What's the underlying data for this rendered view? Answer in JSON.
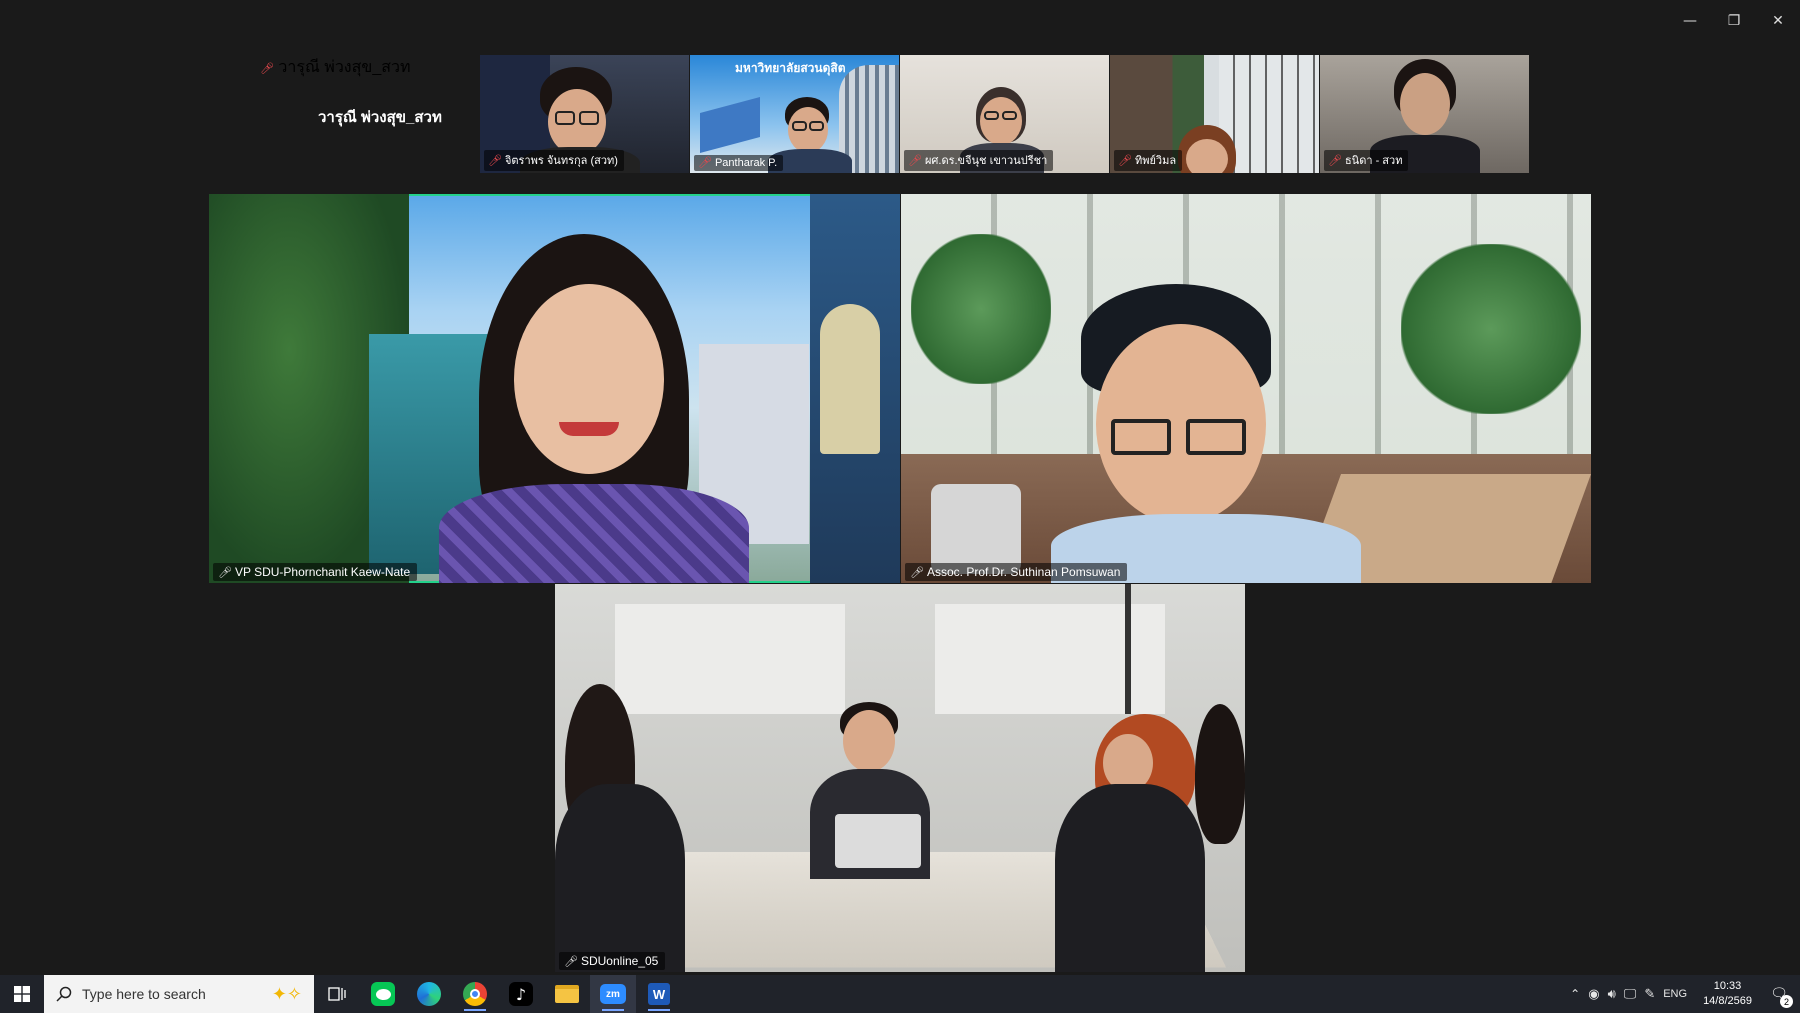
{
  "window": {
    "minimize_icon": "—",
    "restore_icon": "❐",
    "close_icon": "✕"
  },
  "self_view": {
    "title": "วารุณี พ่วงสุข_สวท",
    "name": "วารุณี พ่วงสุข_สวท"
  },
  "strip": [
    {
      "name": "จิตราพร จันทรกุล (สวท)"
    },
    {
      "name": "Pantharak P.",
      "banner": "มหาวิทยาลัยสวนดุสิต"
    },
    {
      "name": "ผศ.ดร.ขจีนุช เขาวนปรีชา"
    },
    {
      "name": "ทิพย์วิมล"
    },
    {
      "name": "ธนิดา - สวท"
    }
  ],
  "main": [
    {
      "name": "VP SDU-Phornchanit Kaew-Nate"
    },
    {
      "name": "Assoc. Prof.Dr. Suthinan Pomsuwan"
    },
    {
      "name": "SDUonline_05"
    }
  ],
  "taskbar": {
    "search_placeholder": "Type here to search",
    "apps": [
      "task-view",
      "line",
      "edge",
      "chrome",
      "tiktok",
      "file-explorer",
      "zoom",
      "word"
    ],
    "zoom_label": "zm",
    "language": "ENG",
    "time": "10:33",
    "date": "14/8/2569",
    "notification_count": "2"
  },
  "colors": {
    "active_speaker": "#23d18b",
    "mic_muted": "#e5484d",
    "taskbar": "#20232a"
  }
}
